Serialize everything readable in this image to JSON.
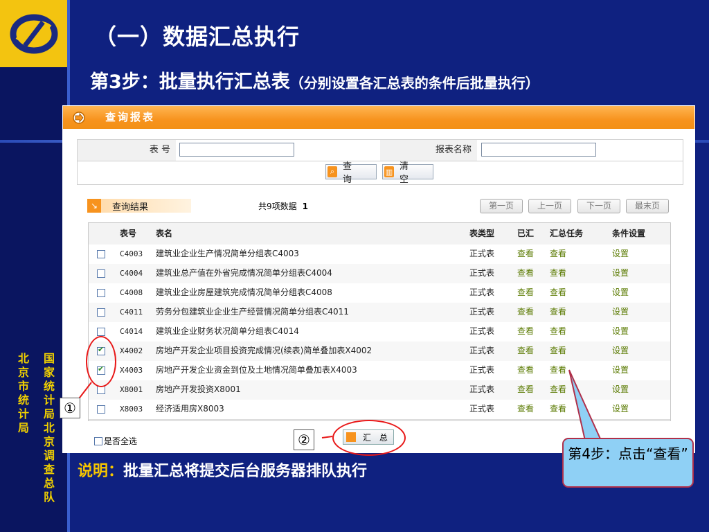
{
  "slide": {
    "title": "（一）数据汇总执行",
    "step_main": "第3步：批量执行汇总表",
    "step_sub": "（分别设置各汇总表的条件后批量执行）",
    "side_text_col1": "国家统计局北京调查总队",
    "side_text_col2": "北 京 市 统 计 局",
    "note_label": "说明：",
    "note_text": "批量汇总将提交后台服务器排队执行",
    "callout_text": "第4步：点击“查看”",
    "marker1": "①",
    "marker2": "②"
  },
  "panel": {
    "title": "查询报表",
    "query": {
      "code_label": "表  号",
      "code_value": "",
      "name_label": "报表名称",
      "name_value": "",
      "search_button": "查 询",
      "clear_button": "清 空"
    },
    "results": {
      "title": "查询结果",
      "count_text": "共9项数据",
      "page_number": "1",
      "pager": [
        "第一页",
        "上一页",
        "下一页",
        "最末页"
      ]
    },
    "table": {
      "headers": [
        "",
        "表号",
        "表名",
        "表类型",
        "已汇",
        "汇总任务",
        "条件设置"
      ],
      "rows": [
        {
          "checked": false,
          "code": "C4003",
          "name": "建筑业企业生产情况简单分组表C4003",
          "type": "正式表",
          "done": "查看",
          "task": "查看",
          "cond": "设置"
        },
        {
          "checked": false,
          "code": "C4004",
          "name": "建筑业总产值在外省完成情况简单分组表C4004",
          "type": "正式表",
          "done": "查看",
          "task": "查看",
          "cond": "设置"
        },
        {
          "checked": false,
          "code": "C4008",
          "name": "建筑业企业房屋建筑完成情况简单分组表C4008",
          "type": "正式表",
          "done": "查看",
          "task": "查看",
          "cond": "设置"
        },
        {
          "checked": false,
          "code": "C4011",
          "name": "劳务分包建筑业企业生产经营情况简单分组表C4011",
          "type": "正式表",
          "done": "查看",
          "task": "查看",
          "cond": "设置"
        },
        {
          "checked": false,
          "code": "C4014",
          "name": "建筑业企业财务状况简单分组表C4014",
          "type": "正式表",
          "done": "查看",
          "task": "查看",
          "cond": "设置"
        },
        {
          "checked": true,
          "code": "X4002",
          "name": "房地产开发企业项目投资完成情况(续表)简单叠加表X4002",
          "type": "正式表",
          "done": "查看",
          "task": "查看",
          "cond": "设置"
        },
        {
          "checked": true,
          "code": "X4003",
          "name": "房地产开发企业资金到位及土地情况简单叠加表X4003",
          "type": "正式表",
          "done": "查看",
          "task": "查看",
          "cond": "设置"
        },
        {
          "checked": false,
          "code": "X8001",
          "name": "房地产开发投资X8001",
          "type": "正式表",
          "done": "查看",
          "task": "查看",
          "cond": "设置"
        },
        {
          "checked": false,
          "code": "X8003",
          "name": "经济适用房X8003",
          "type": "正式表",
          "done": "查看",
          "task": "查看",
          "cond": "设置"
        }
      ]
    },
    "select_all_label": "是否全选",
    "summarize_button": "汇 总"
  },
  "colors": {
    "background": "#0f2180",
    "accent_orange": "#f7931e",
    "logo_yellow": "#f3c410",
    "link_green": "#5a7a00",
    "annotation_red": "#e81818",
    "callout_blue": "#8fd0f5"
  }
}
